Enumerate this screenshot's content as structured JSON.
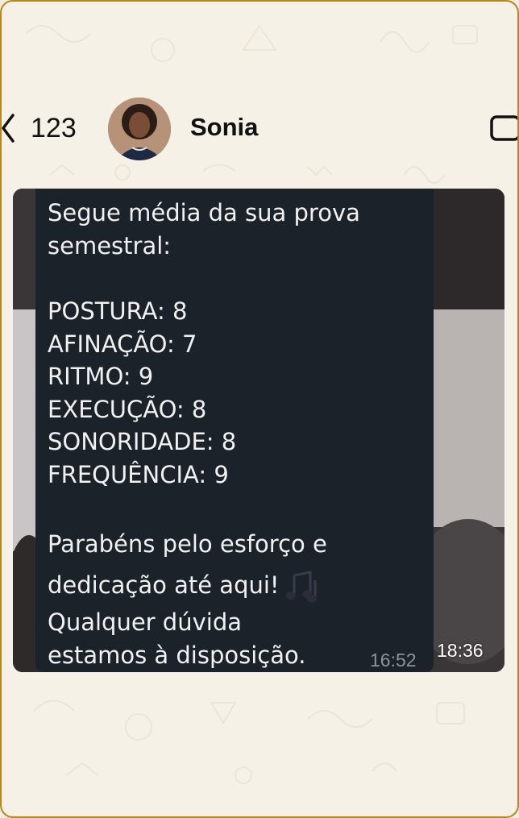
{
  "header": {
    "back_count": "123",
    "contact_name": "Sonia"
  },
  "message": {
    "lines": [
      "Segue média da sua prova",
      "semestral:",
      "POSTURA: 8",
      "AFINAÇÃO: 7",
      "RITMO: 9",
      "EXECUÇÃO: 8",
      "SONORIDADE: 8",
      "FREQUÊNCIA: 9",
      "Parabéns pelo esforço e",
      "dedicação até aqui!",
      "Qualquer dúvida",
      "estamos à disposição."
    ],
    "emoji_icon": "musical-notes-icon",
    "inner_time": "16:52",
    "outer_time": "18:36"
  },
  "colors": {
    "frame_border": "#b8861f",
    "background": "#f6f1e6",
    "bubble": "#1c2229",
    "text": "#f1f1f1"
  }
}
